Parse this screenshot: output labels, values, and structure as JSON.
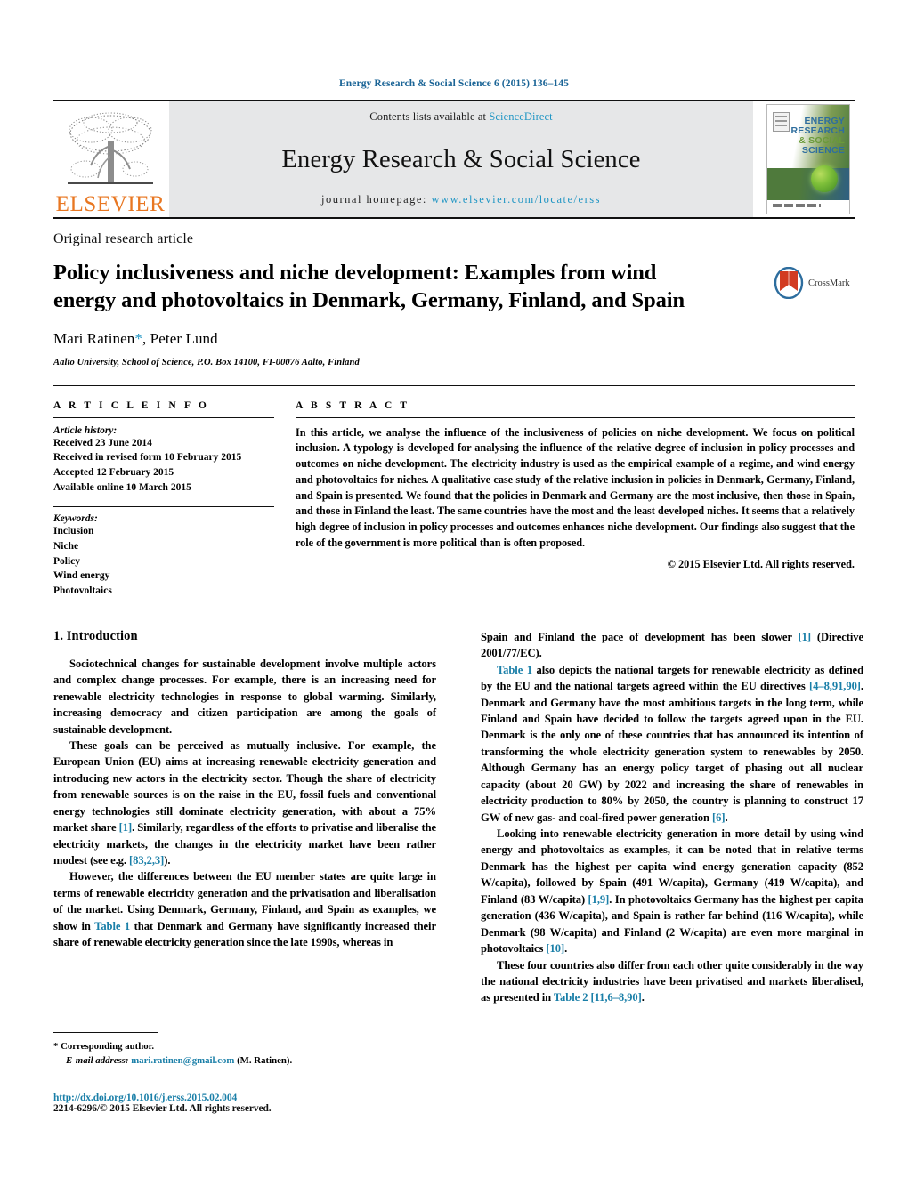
{
  "running_head": "Energy Research & Social Science 6 (2015) 136–145",
  "masthead": {
    "publisher_logo_text": "ELSEVIER",
    "contents_prefix": "Contents lists available at ",
    "contents_link": "ScienceDirect",
    "journal_title": "Energy Research & Social Science",
    "homepage_prefix": "journal homepage: ",
    "homepage_url": "www.elsevier.com/locate/erss",
    "cover": {
      "line1": "ENERGY",
      "line2": "RESEARCH",
      "line3": "& SOCIAL",
      "line4": "SCIENCE"
    }
  },
  "title_block": {
    "article_type": "Original research article",
    "title": "Policy inclusiveness and niche development: Examples from wind energy and photovoltaics in Denmark, Germany, Finland, and Spain",
    "authors_first": "Mari Ratinen",
    "authors_star": "*",
    "authors_rest": ", Peter Lund",
    "affiliation": "Aalto University, School of Science, P.O. Box 14100, FI-00076 Aalto, Finland",
    "crossmark_label": "CrossMark"
  },
  "article_info": {
    "heading": "A R T I C L E    I N F O",
    "history_label": "Article history:",
    "history": [
      "Received 23 June 2014",
      "Received in revised form 10 February 2015",
      "Accepted 12 February 2015",
      "Available online 10 March 2015"
    ],
    "keywords_label": "Keywords:",
    "keywords": [
      "Inclusion",
      "Niche",
      "Policy",
      "Wind energy",
      "Photovoltaics"
    ]
  },
  "abstract": {
    "heading": "A B S T R A C T",
    "text": "In this article, we analyse the influence of the inclusiveness of policies on niche development. We focus on political inclusion. A typology is developed for analysing the influence of the relative degree of inclusion in policy processes and outcomes on niche development. The electricity industry is used as the empirical example of a regime, and wind energy and photovoltaics for niches. A qualitative case study of the relative inclusion in policies in Denmark, Germany, Finland, and Spain is presented. We found that the policies in Denmark and Germany are the most inclusive, then those in Spain, and those in Finland the least. The same countries have the most and the least developed niches. It seems that a relatively high degree of inclusion in policy processes and outcomes enhances niche development. Our findings also suggest that the role of the government is more political than is often proposed.",
    "copyright": "© 2015 Elsevier Ltd. All rights reserved."
  },
  "body": {
    "section_title": "1. Introduction",
    "left_paragraphs": [
      "Sociotechnical changes for sustainable development involve multiple actors and complex change processes. For example, there is an increasing need for renewable electricity technologies in response to global warming. Similarly, increasing democracy and citizen participation are among the goals of sustainable development.",
      "These goals can be perceived as mutually inclusive. For example, the European Union (EU) aims at increasing renewable electricity generation and introducing new actors in the electricity sector. Though the share of electricity from renewable sources is on the raise in the EU, fossil fuels and conventional energy technologies still dominate electricity generation, with about a 75% market share [1]. Similarly, regardless of the efforts to privatise and liberalise the electricity markets, the changes in the electricity market have been rather modest (see e.g. [83,2,3]).",
      "However, the differences between the EU member states are quite large in terms of renewable electricity generation and the privatisation and liberalisation of the market. Using Denmark, Germany, Finland, and Spain as examples, we show in Table 1 that Denmark and Germany have significantly increased their share of renewable electricity generation since the late 1990s, whereas in"
    ],
    "right_paragraphs": [
      "Spain and Finland the pace of development has been slower [1] (Directive 2001/77/EC).",
      "Table 1 also depicts the national targets for renewable electricity as defined by the EU and the national targets agreed within the EU directives [4–8,91,90]. Denmark and Germany have the most ambitious targets in the long term, while Finland and Spain have decided to follow the targets agreed upon in the EU. Denmark is the only one of these countries that has announced its intention of transforming the whole electricity generation system to renewables by 2050. Although Germany has an energy policy target of phasing out all nuclear capacity (about 20 GW) by 2022 and increasing the share of renewables in electricity production to 80% by 2050, the country is planning to construct 17 GW of new gas- and coal-fired power generation [6].",
      "Looking into renewable electricity generation in more detail by using wind energy and photovoltaics as examples, it can be noted that in relative terms Denmark has the highest per capita wind energy generation capacity (852 W/capita), followed by Spain (491 W/capita), Germany (419 W/capita), and Finland (83 W/capita) [1,9]. In photovoltaics Germany has the highest per capita generation (436 W/capita), and Spain is rather far behind (116 W/capita), while Denmark (98 W/capita) and Finland (2 W/capita) are even more marginal in photovoltaics [10].",
      "These four countries also differ from each other quite considerably in the way the national electricity industries have been privatised and markets liberalised, as presented in Table 2 [11,6–8,90]."
    ]
  },
  "footnote": {
    "corresponding": "* Corresponding author.",
    "email_label": "E-mail address:",
    "email": "mari.ratinen@gmail.com",
    "email_suffix": " (M. Ratinen).",
    "doi": "http://dx.doi.org/10.1016/j.erss.2015.02.004",
    "issn": "2214-6296/© 2015 Elsevier Ltd. All rights reserved."
  },
  "colors": {
    "link": "#1a7fa8",
    "elsevier_orange": "#E87722",
    "masthead_bg": "#e6e7e8"
  }
}
